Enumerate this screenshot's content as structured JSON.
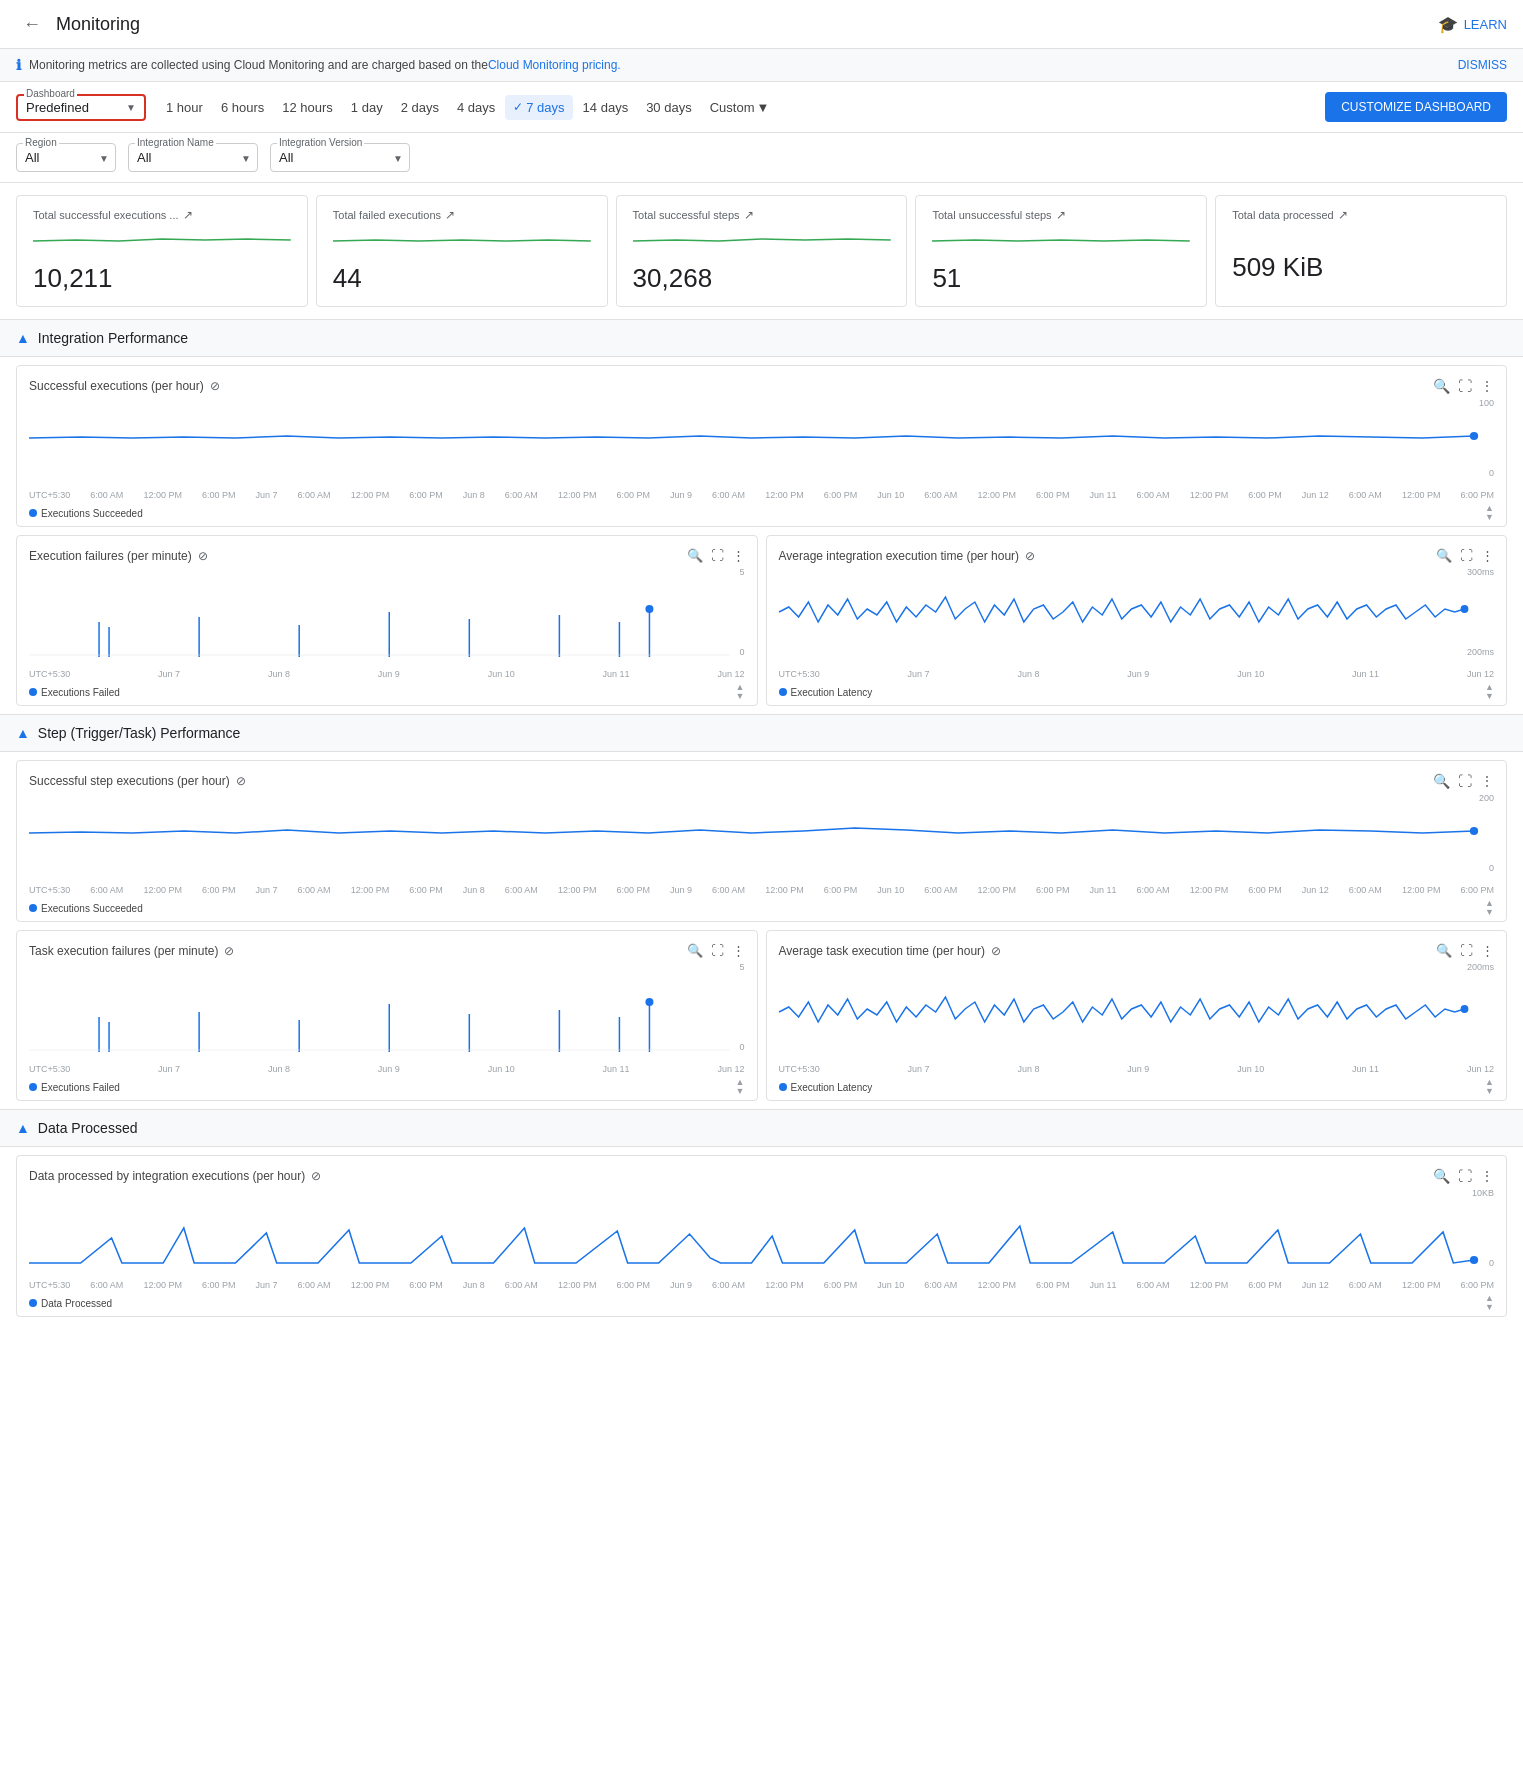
{
  "header": {
    "title": "Monitoring",
    "learn_label": "LEARN",
    "back_icon": "←"
  },
  "info_bar": {
    "message": "Monitoring metrics are collected using Cloud Monitoring and are charged based on the ",
    "link_text": "Cloud Monitoring pricing.",
    "dismiss_label": "DISMISS"
  },
  "controls": {
    "dashboard_label": "Dashboard",
    "dashboard_value": "Predefined",
    "time_options": [
      {
        "label": "1 hour",
        "active": false
      },
      {
        "label": "6 hours",
        "active": false
      },
      {
        "label": "12 hours",
        "active": false
      },
      {
        "label": "1 day",
        "active": false
      },
      {
        "label": "2 days",
        "active": false
      },
      {
        "label": "4 days",
        "active": false
      },
      {
        "label": "7 days",
        "active": true
      },
      {
        "label": "14 days",
        "active": false
      },
      {
        "label": "30 days",
        "active": false
      },
      {
        "label": "Custom",
        "active": false,
        "has_arrow": true
      }
    ],
    "customize_label": "CUSTOMIZE DASHBOARD",
    "customize_icon": "✏"
  },
  "filters": {
    "region_label": "Region",
    "region_value": "All",
    "integration_name_label": "Integration Name",
    "integration_name_value": "All",
    "integration_version_label": "Integration Version",
    "integration_version_value": "All"
  },
  "stats": [
    {
      "title": "Total successful executions ...",
      "value": "10,211",
      "has_chart": true
    },
    {
      "title": "Total failed executions",
      "value": "44",
      "has_chart": true
    },
    {
      "title": "Total successful steps",
      "value": "30,268",
      "has_chart": true
    },
    {
      "title": "Total unsuccessful steps",
      "value": "51",
      "has_chart": true
    },
    {
      "title": "Total data processed",
      "value": "509 KiB",
      "has_chart": false
    }
  ],
  "sections": [
    {
      "id": "integration-performance",
      "title": "Integration Performance",
      "charts": [
        {
          "id": "successful-executions",
          "title": "Successful executions (per hour)",
          "legend": "Executions Succeeded",
          "scale_top": "100",
          "scale_bottom": "0",
          "full_width": true,
          "x_labels": [
            "UTC+5:30",
            "6:00 AM",
            "12:00 PM",
            "6:00 PM",
            "Jun 7",
            "6:00 AM",
            "12:00 PM",
            "6:00 PM",
            "Jun 8",
            "6:00 AM",
            "12:00 PM",
            "6:00 PM",
            "Jun 9",
            "6:00 AM",
            "12:00 PM",
            "6:00 PM",
            "Jun 10",
            "6:00 AM",
            "12:00 PM",
            "6:00 PM",
            "Jun 11",
            "6:00 AM",
            "12:00 PM",
            "6:00 PM",
            "Jun 12",
            "6:00 AM",
            "12:00 PM",
            "6:00 PM"
          ]
        },
        {
          "id": "execution-failures",
          "title": "Execution failures (per minute)",
          "legend": "Executions Failed",
          "scale_top": "5",
          "scale_bottom": "0",
          "full_width": false,
          "x_labels": [
            "UTC+5:30",
            "Jun 7",
            "Jun 8",
            "Jun 9",
            "Jun 10",
            "Jun 11",
            "Jun 12"
          ]
        },
        {
          "id": "avg-execution-time",
          "title": "Average integration execution time (per hour)",
          "legend": "Execution Latency",
          "scale_top": "300ms",
          "scale_bottom": "200ms",
          "full_width": false,
          "x_labels": [
            "UTC+5:30",
            "Jun 7",
            "Jun 8",
            "Jun 9",
            "Jun 10",
            "Jun 11",
            "Jun 12"
          ]
        }
      ]
    },
    {
      "id": "step-performance",
      "title": "Step (Trigger/Task) Performance",
      "charts": [
        {
          "id": "successful-step-executions",
          "title": "Successful step executions (per hour)",
          "legend": "Executions Succeeded",
          "scale_top": "200",
          "scale_bottom": "0",
          "full_width": true,
          "x_labels": [
            "UTC+5:30",
            "6:00 AM",
            "12:00 PM",
            "6:00 PM",
            "Jun 7",
            "6:00 AM",
            "12:00 PM",
            "6:00 PM",
            "Jun 8",
            "6:00 AM",
            "12:00 PM",
            "6:00 PM",
            "Jun 9",
            "6:00 AM",
            "12:00 PM",
            "6:00 PM",
            "Jun 10",
            "6:00 AM",
            "12:00 PM",
            "6:00 PM",
            "Jun 11",
            "6:00 AM",
            "12:00 PM",
            "6:00 PM",
            "Jun 12",
            "6:00 AM",
            "12:00 PM",
            "6:00 PM"
          ]
        },
        {
          "id": "task-execution-failures",
          "title": "Task execution failures (per minute)",
          "legend": "Executions Failed",
          "scale_top": "5",
          "scale_bottom": "0",
          "full_width": false,
          "x_labels": [
            "UTC+5:30",
            "Jun 7",
            "Jun 8",
            "Jun 9",
            "Jun 10",
            "Jun 11",
            "Jun 12"
          ]
        },
        {
          "id": "avg-task-execution-time",
          "title": "Average task execution time (per hour)",
          "legend": "Execution Latency",
          "scale_top": "200ms",
          "scale_bottom": "",
          "full_width": false,
          "x_labels": [
            "UTC+5:30",
            "Jun 7",
            "Jun 8",
            "Jun 9",
            "Jun 10",
            "Jun 11",
            "Jun 12"
          ]
        }
      ]
    },
    {
      "id": "data-processed",
      "title": "Data Processed",
      "charts": [
        {
          "id": "data-processed-chart",
          "title": "Data processed by integration executions (per hour)",
          "legend": "Data Processed",
          "scale_top": "10KB",
          "scale_bottom": "0",
          "full_width": true,
          "x_labels": [
            "UTC+5:30",
            "6:00 AM",
            "12:00 PM",
            "6:00 PM",
            "Jun 7",
            "6:00 AM",
            "12:00 PM",
            "6:00 PM",
            "Jun 8",
            "6:00 AM",
            "12:00 PM",
            "6:00 PM",
            "Jun 9",
            "6:00 AM",
            "12:00 PM",
            "6:00 PM",
            "Jun 10",
            "6:00 AM",
            "12:00 PM",
            "6:00 PM",
            "Jun 11",
            "6:00 AM",
            "12:00 PM",
            "6:00 PM",
            "Jun 12",
            "6:00 AM",
            "12:00 PM",
            "6:00 PM"
          ]
        }
      ]
    }
  ]
}
